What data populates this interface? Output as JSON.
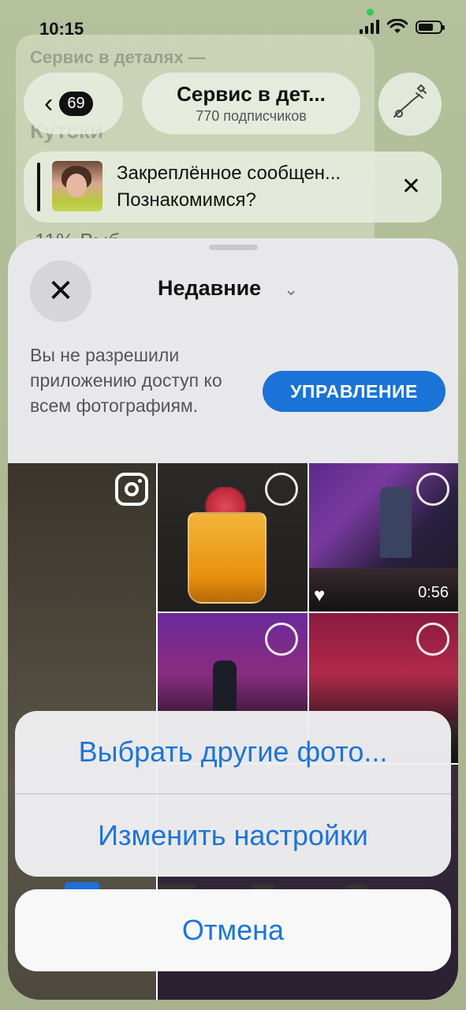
{
  "status_bar": {
    "time": "10:15"
  },
  "background_chat": {
    "line1": "Сервис в деталях —",
    "line2": "Кутски",
    "line3": "11% Выб..."
  },
  "header": {
    "unread_count": "69",
    "channel_title": "Сервис в дет...",
    "subscribers": "770 подписчиков"
  },
  "pinned": {
    "title": "Закреплённое сообщен...",
    "text": "Познакомимся?"
  },
  "picker": {
    "album_title": "Недавние",
    "permission_text": "Вы не разрешили приложению доступ ко всем фотографиям.",
    "manage_button": "УПРАВЛЕНИЕ",
    "video_duration": "0:56"
  },
  "action_sheet": {
    "select_more": "Выбрать другие фото...",
    "change_settings": "Изменить настройки",
    "cancel": "Отмена"
  },
  "colors": {
    "accent": "#1c75d8",
    "button_blue": "#1a73d6"
  }
}
